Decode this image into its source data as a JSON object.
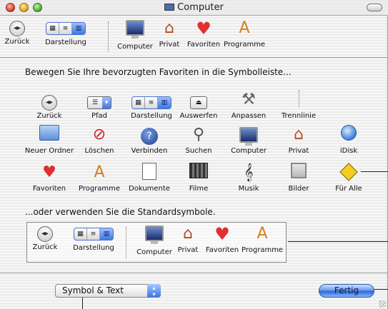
{
  "window": {
    "title": "Computer"
  },
  "toolbar": {
    "items": [
      {
        "label": "Zurück",
        "icon": "back-arrow-icon"
      },
      {
        "label": "Darstellung",
        "icon": "view-mode-icon"
      },
      {
        "label": "Computer",
        "icon": "computer-icon"
      },
      {
        "label": "Privat",
        "icon": "home-icon"
      },
      {
        "label": "Favoriten",
        "icon": "heart-icon"
      },
      {
        "label": "Programme",
        "icon": "applications-icon"
      }
    ]
  },
  "sheet": {
    "instruction": "Bewegen Sie Ihre bevorzugten Favoriten in die Symbolleiste...",
    "palette": [
      {
        "label": "Zurück",
        "icon": "back-arrow-icon"
      },
      {
        "label": "Pfad",
        "icon": "path-popup-icon"
      },
      {
        "label": "Darstellung",
        "icon": "view-mode-icon"
      },
      {
        "label": "Auswerfen",
        "icon": "eject-icon"
      },
      {
        "label": "Anpassen",
        "icon": "customize-tools-icon"
      },
      {
        "label": "Trennlinie",
        "icon": "separator-icon"
      },
      {
        "label": "Neuer Ordner",
        "icon": "new-folder-icon"
      },
      {
        "label": "Löschen",
        "icon": "delete-icon"
      },
      {
        "label": "Verbinden",
        "icon": "connect-icon"
      },
      {
        "label": "Suchen",
        "icon": "search-icon"
      },
      {
        "label": "Computer",
        "icon": "computer-icon"
      },
      {
        "label": "Privat",
        "icon": "home-icon"
      },
      {
        "label": "iDisk",
        "icon": "idisk-icon"
      },
      {
        "label": "Favoriten",
        "icon": "heart-icon"
      },
      {
        "label": "Programme",
        "icon": "applications-icon"
      },
      {
        "label": "Dokumente",
        "icon": "documents-icon"
      },
      {
        "label": "Filme",
        "icon": "movies-icon"
      },
      {
        "label": "Musik",
        "icon": "music-icon"
      },
      {
        "label": "Bilder",
        "icon": "pictures-icon"
      },
      {
        "label": "Für Alle",
        "icon": "shared-icon"
      }
    ],
    "default_text": "...oder verwenden Sie die Standardsymbole.",
    "default_set": [
      {
        "label": "Zurück",
        "icon": "back-arrow-icon"
      },
      {
        "label": "Darstellung",
        "icon": "view-mode-icon"
      },
      {
        "label": "Computer",
        "icon": "computer-icon"
      },
      {
        "label": "Privat",
        "icon": "home-icon"
      },
      {
        "label": "Favoriten",
        "icon": "heart-icon"
      },
      {
        "label": "Programme",
        "icon": "applications-icon"
      }
    ]
  },
  "footer": {
    "show_select": {
      "value": "Symbol & Text"
    },
    "done_label": "Fertig"
  }
}
